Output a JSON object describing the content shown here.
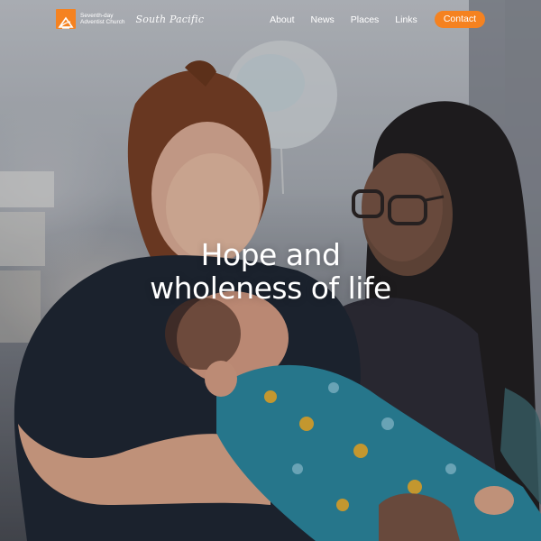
{
  "brand": {
    "line1": "Seventh-day",
    "line2": "Adventist Church",
    "script_name": "South Pacific",
    "accent_color": "#f58220"
  },
  "nav": {
    "items": [
      {
        "label": "About"
      },
      {
        "label": "News"
      },
      {
        "label": "Places"
      },
      {
        "label": "Links"
      }
    ],
    "contact_label": "Contact"
  },
  "hero": {
    "headline_line1": "Hope and",
    "headline_line2": "wholeness of life",
    "image_subject": "nurse and mother holding a baby"
  }
}
